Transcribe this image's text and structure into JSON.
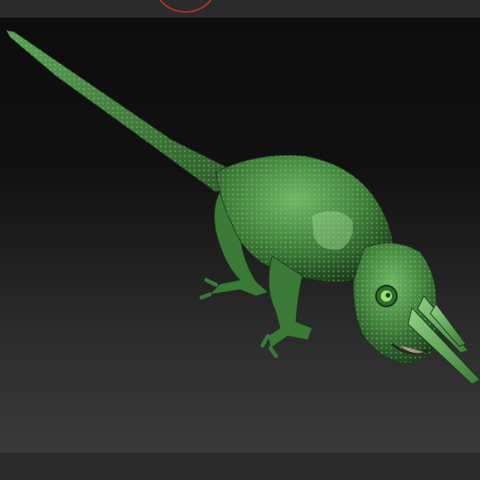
{
  "app": {
    "type": "3d-sculpt-viewport"
  },
  "viewport": {
    "subject": "chameleon-model",
    "colors": {
      "background_top": "#0d0d0d",
      "background_bottom": "#3a3a3a",
      "model_dark": "#1f3d1f",
      "model_mid": "#3f7f3a",
      "model_light": "#6fb866",
      "accent_ring": "#b8302b"
    }
  }
}
